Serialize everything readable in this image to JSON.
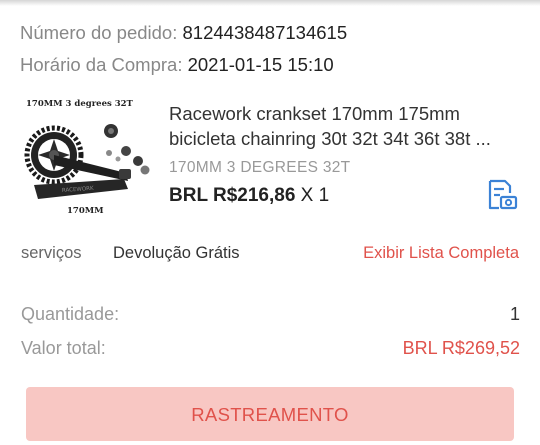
{
  "order": {
    "number_label": "Número do pedido:",
    "number_value": "8124438487134615",
    "time_label": "Horário da Compra:",
    "time_value": "2021-01-15 15:10"
  },
  "product": {
    "image_caption_top": "170MM  3 degrees 32T",
    "image_caption_bottom": "170MM",
    "title_line1": "Racework crankset 170mm 175mm",
    "title_line2": "bicicleta chainring 30t 32t 34t 36t 38t ...",
    "variant": "170MM 3 DEGREES 32T",
    "price": "BRL R$216,86",
    "quantity_text": "X 1",
    "icon": "document-camera-icon"
  },
  "services": {
    "label": "serviços",
    "value": "Devolução Grátis",
    "link": "Exibir Lista Completa"
  },
  "summary": {
    "quantity_label": "Quantidade:",
    "quantity_value": "1",
    "total_label": "Valor total:",
    "total_value": "BRL R$269,52"
  },
  "actions": {
    "track_label": "RASTREAMENTO"
  },
  "colors": {
    "accent": "#e0524b",
    "button_bg": "#f8c7c3",
    "icon_blue": "#3b82d6"
  }
}
